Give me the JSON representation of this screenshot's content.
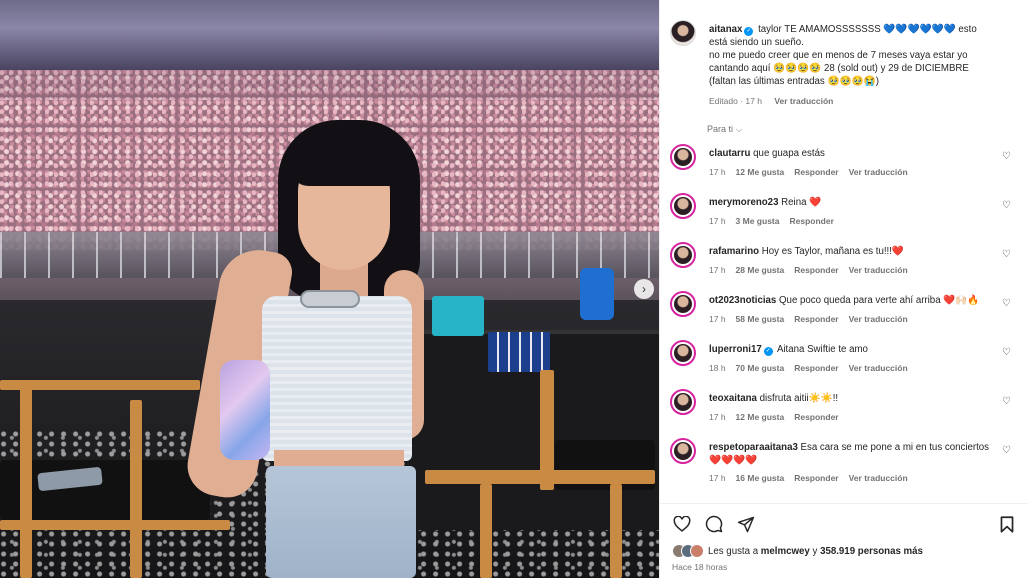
{
  "post": {
    "author": "aitanax",
    "caption_line1": "taylor TE AMAMOSSSSSSS 💙💙💙💙💙💙 esto",
    "caption_line2": "está siendo un sueño.",
    "caption_line3": "no me puedo creer que en menos de 7 meses vaya estar yo",
    "caption_line4": "cantando aquí 🥹🥹🥹🥹 28 (sold out) y 29 de DICIEMBRE",
    "caption_line5": "(faltan las últimas entradas 🥹🥹🥹😭)",
    "edited_label": "Editado · 17 h",
    "translate_label": "Ver traducción"
  },
  "sort_label": "Para ti",
  "comments": [
    {
      "user": "clautarru",
      "text": "que guapa estás",
      "time": "17 h",
      "likes": "12 Me gusta",
      "reply": "Responder",
      "translate": "Ver traducción"
    },
    {
      "user": "merymoreno23",
      "text": "Reina ❤️",
      "time": "17 h",
      "likes": "3 Me gusta",
      "reply": "Responder",
      "translate": ""
    },
    {
      "user": "rafamarino",
      "text": "Hoy es Taylor, mañana es tu!!!❤️",
      "time": "17 h",
      "likes": "28 Me gusta",
      "reply": "Responder",
      "translate": "Ver traducción"
    },
    {
      "user": "ot2023noticias",
      "text": "Que poco queda para verte ahí arriba ❤️🙌🏻🔥",
      "time": "17 h",
      "likes": "58 Me gusta",
      "reply": "Responder",
      "translate": "Ver traducción"
    },
    {
      "user": "luperroni17",
      "text": "Aitana Swiftie te amo",
      "time": "18 h",
      "likes": "70 Me gusta",
      "reply": "Responder",
      "translate": "Ver traducción"
    },
    {
      "user": "teoxaitana",
      "text": "disfruta aitii☀️☀️!!",
      "time": "17 h",
      "likes": "12 Me gusta",
      "reply": "Responder",
      "translate": ""
    },
    {
      "user": "respetoparaaitana3",
      "text": "Esa cara se me pone a mi en tus conciertos ❤️❤️❤️❤️",
      "time": "17 h",
      "likes": "16 Me gusta",
      "reply": "Responder",
      "translate": "Ver traducción"
    }
  ],
  "likes_prefix": "Les gusta a",
  "likes_user": "melmcwey",
  "likes_middle": "y",
  "likes_count": "358.919 personas más",
  "time_ago": "Hace 18 horas",
  "colors": {
    "verified": "#0095f6",
    "story_ring": "#d6249f",
    "muted": "#737373"
  }
}
